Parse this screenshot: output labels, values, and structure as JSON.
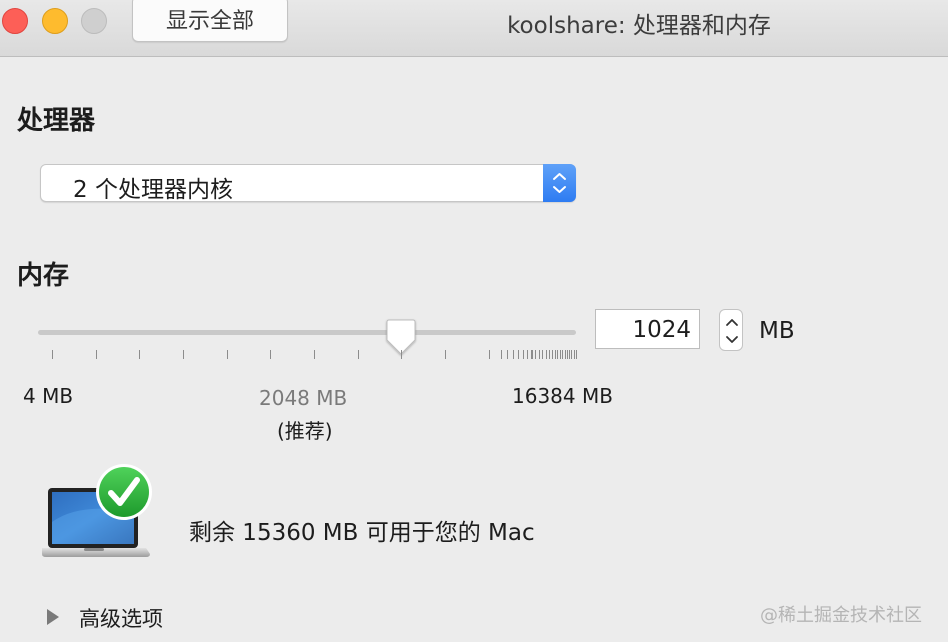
{
  "window": {
    "title": "koolshare: 处理器和内存",
    "show_all_label": "显示全部"
  },
  "processor": {
    "heading": "处理器",
    "selected": "2 个处理器内核"
  },
  "memory": {
    "heading": "内存",
    "value": "1024",
    "unit": "MB",
    "slider_value_mb": 1024,
    "slider_min_label": "4 MB",
    "slider_mid_label": "2048 MB",
    "slider_mid_sublabel": "(推荐)",
    "slider_max_label": "16384 MB"
  },
  "status": {
    "available_text": "剩余 15360 MB 可用于您的 Mac"
  },
  "advanced": {
    "label": "高级选项"
  },
  "watermark": "@稀土掘金技术社区",
  "colors": {
    "accent": "#2e7cf2",
    "check_green": "#2cab3a",
    "close": "#fd5f57",
    "minimize": "#febb2e"
  }
}
